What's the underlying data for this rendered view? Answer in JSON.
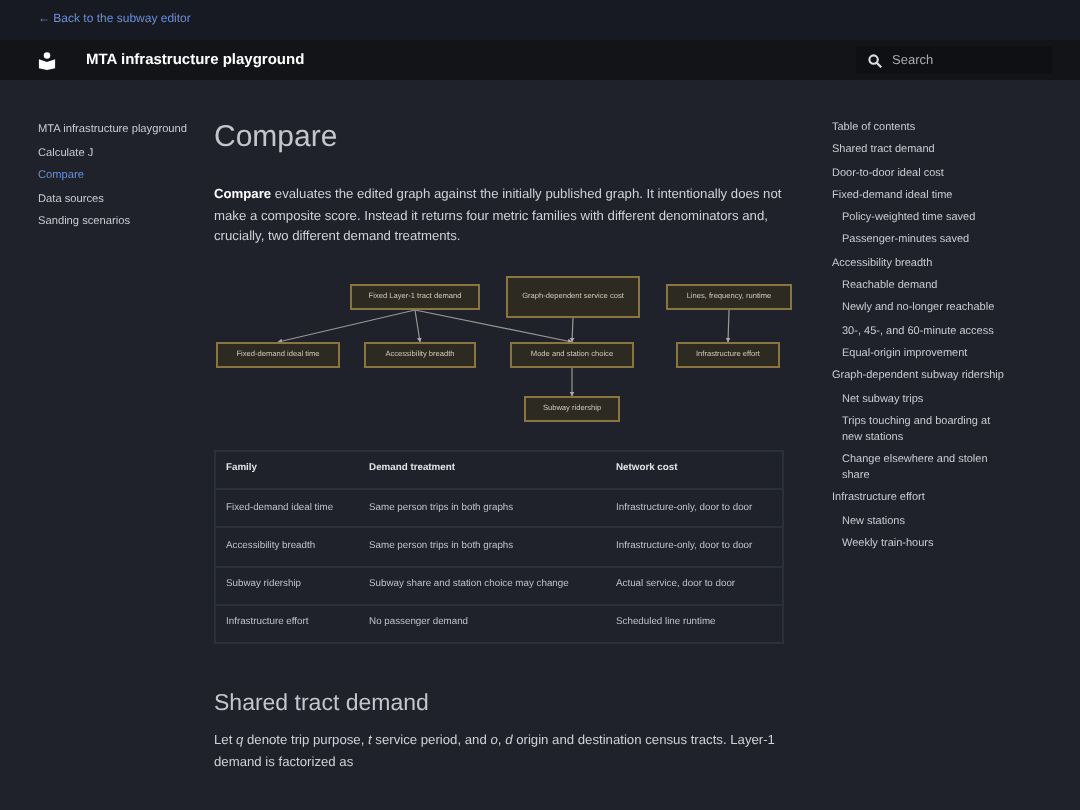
{
  "back_link": "← Back to the subway editor",
  "navbar": {
    "title": "MTA infrastructure playground",
    "search": {
      "placeholder": "Search"
    }
  },
  "sidebar": {
    "items": [
      {
        "label": "MTA infrastructure playground",
        "selected": false
      },
      {
        "label": "Calculate J",
        "selected": false
      },
      {
        "label": "Compare",
        "selected": true
      },
      {
        "label": "Data sources",
        "selected": false
      },
      {
        "label": "Sanding scenarios",
        "selected": false
      }
    ]
  },
  "main": {
    "heading": "Compare",
    "intro": "**Compare** evaluates the edited graph against the initially published graph. It intentionally does not make a composite score. Instead it returns four metric families with different denominators and, crucially, two different demand treatments.",
    "diagram": {
      "nodes": [
        {
          "label": "Fixed Layer-1 tract demand"
        },
        {
          "label": "Graph-dependent service cost"
        },
        {
          "label": "Lines, frequency, runtime"
        },
        {
          "label": "Fixed-demand ideal time"
        },
        {
          "label": "Accessibility breadth"
        },
        {
          "label": "Mode and station choice"
        },
        {
          "label": "Infrastructure effort"
        },
        {
          "label": "Subway ridership"
        }
      ]
    },
    "table": {
      "columns": [
        "Family",
        "Demand treatment",
        "Network cost"
      ],
      "rows": [
        [
          "Fixed-demand ideal time",
          "Same person trips in both graphs",
          "Infrastructure-only, door to door"
        ],
        [
          "Accessibility breadth",
          "Same person trips in both graphs",
          "Infrastructure-only, door to door"
        ],
        [
          "Subway ridership",
          "Subway share and station choice may change",
          "Actual service, door to door"
        ],
        [
          "Infrastructure effort",
          "No passenger demand",
          "Scheduled line runtime"
        ]
      ]
    },
    "section_heading": "Shared tract demand",
    "section_text": "Let *q* denote trip purpose, *t* service period, and *o*, *d* origin and destination census tracts. Layer-1 demand is factorized as"
  },
  "toc": {
    "title": "Table of contents",
    "items": [
      {
        "label": "Shared tract demand"
      },
      {
        "label": "Door-to-door ideal cost"
      },
      {
        "label": "Fixed-demand ideal time",
        "children": [
          {
            "label": "Policy-weighted time saved"
          },
          {
            "label": "Passenger-minutes saved"
          }
        ]
      },
      {
        "label": "Accessibility breadth",
        "children": [
          {
            "label": "Reachable demand"
          },
          {
            "label": "Newly and no-longer reachable"
          },
          {
            "label": "30-, 45-, and 60-minute access"
          },
          {
            "label": "Equal-origin improvement"
          }
        ]
      },
      {
        "label": "Graph-dependent subway ridership",
        "children": [
          {
            "label": "Net subway trips"
          },
          {
            "label": "Trips touching and boarding at new stations"
          },
          {
            "label": "Change elsewhere and stolen share"
          }
        ]
      },
      {
        "label": "Infrastructure effort",
        "children": [
          {
            "label": "New stations"
          },
          {
            "label": "Weekly train-hours"
          }
        ]
      }
    ]
  }
}
